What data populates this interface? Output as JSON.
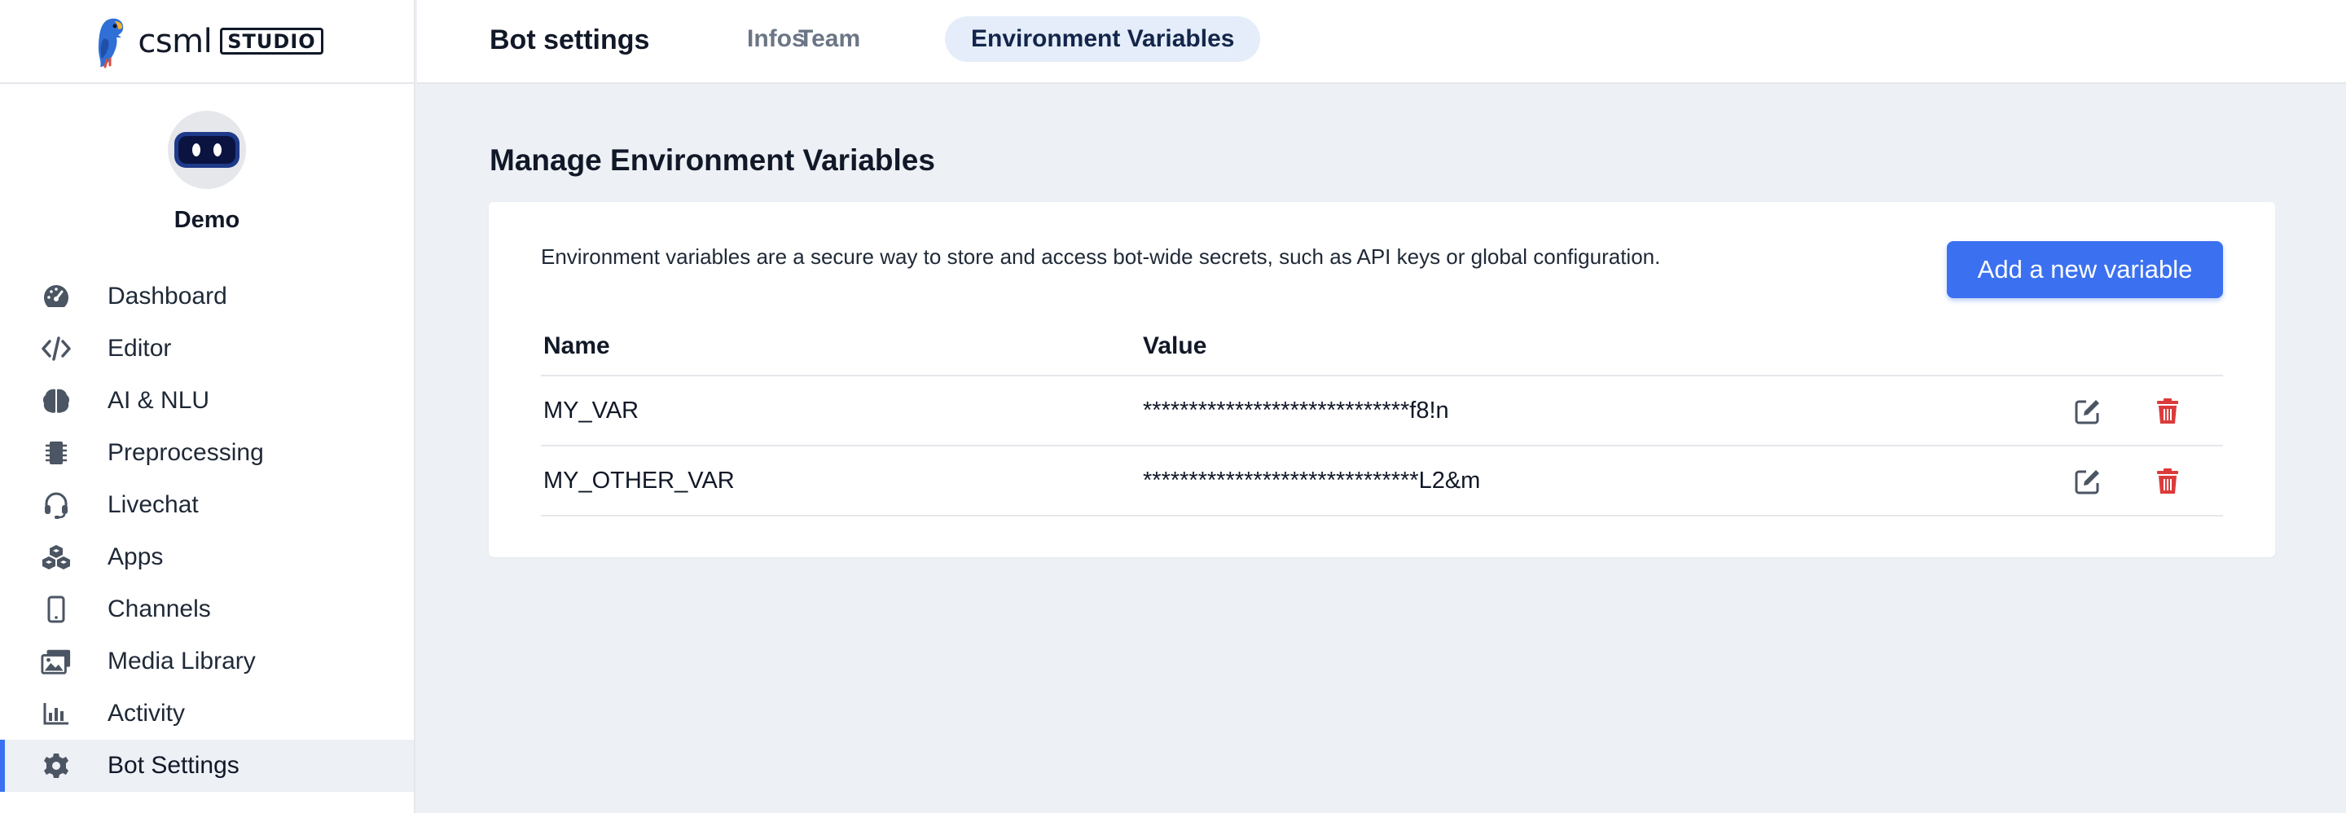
{
  "brand": {
    "logo_text": "csml",
    "logo_badge": "STUDIO",
    "accent": "#3b71f0"
  },
  "bot": {
    "name": "Demo"
  },
  "sidebar": {
    "items": [
      {
        "label": "Dashboard",
        "icon": "gauge-icon"
      },
      {
        "label": "Editor",
        "icon": "code-icon"
      },
      {
        "label": "AI & NLU",
        "icon": "brain-icon"
      },
      {
        "label": "Preprocessing",
        "icon": "chip-icon"
      },
      {
        "label": "Livechat",
        "icon": "headset-icon"
      },
      {
        "label": "Apps",
        "icon": "cubes-icon"
      },
      {
        "label": "Channels",
        "icon": "mobile-icon"
      },
      {
        "label": "Media Library",
        "icon": "images-icon"
      },
      {
        "label": "Activity",
        "icon": "bar-chart-icon"
      },
      {
        "label": "Bot Settings",
        "icon": "gear-icon",
        "active": true
      }
    ]
  },
  "header": {
    "title": "Bot settings",
    "tabs": [
      {
        "label": "Infos"
      },
      {
        "label": "Team"
      },
      {
        "label": "Environment Variables",
        "active": true
      }
    ]
  },
  "main": {
    "section_title": "Manage Environment Variables",
    "description": "Environment variables are a secure way to store and access bot-wide secrets, such as API keys or global configuration.",
    "add_button_label": "Add a new variable",
    "table": {
      "columns": [
        "Name",
        "Value"
      ],
      "rows": [
        {
          "name": "MY_VAR",
          "value": "*****************************f8!n"
        },
        {
          "name": "MY_OTHER_VAR",
          "value": "******************************L2&m"
        }
      ]
    }
  },
  "colors": {
    "delete": "#dc3b3b",
    "edit": "#4b5563",
    "active_tab_bg": "#e4edf9"
  }
}
